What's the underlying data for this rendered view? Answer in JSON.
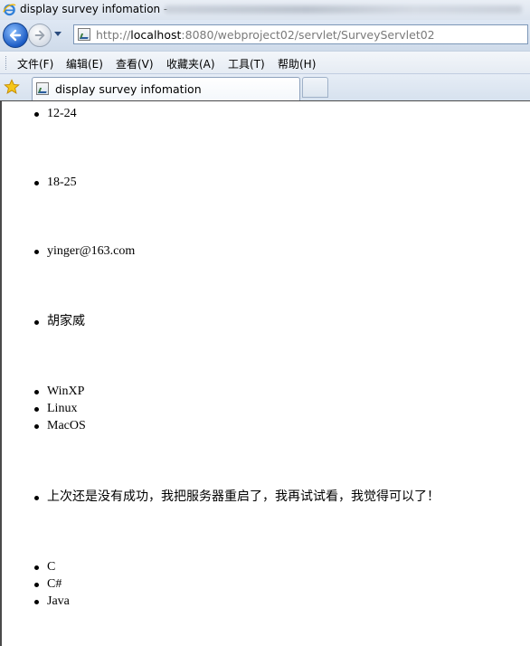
{
  "window": {
    "title": "display survey infomation -",
    "colors": {
      "chrome": "#dbe3ee",
      "title_blur": "#c0c8d2"
    }
  },
  "address_bar": {
    "url_prefix": "http://",
    "url_host": "localhost",
    "url_rest": ":8080/webproject02/servlet/SurveyServlet02"
  },
  "menu": {
    "items": [
      "文件(F)",
      "编辑(E)",
      "查看(V)",
      "收藏夹(A)",
      "工具(T)",
      "帮助(H)"
    ]
  },
  "tabs": {
    "active_title": "display survey infomation"
  },
  "icons": {
    "browser": "ie-logo-icon",
    "back": "back-arrow-icon",
    "forward": "forward-arrow-icon",
    "favorites": "star-icon",
    "page": "page-icon"
  },
  "survey": {
    "age_range": [
      "12-24"
    ],
    "age_group": [
      "18-25"
    ],
    "email": [
      "yinger@163.com"
    ],
    "name": [
      "胡家威"
    ],
    "os": [
      "WinXP",
      "Linux",
      "MacOS"
    ],
    "comment": [
      "上次还是没有成功，我把服务器重启了，我再试试看，我觉得可以了！"
    ],
    "languages": [
      "C",
      "C#",
      "Java"
    ]
  }
}
